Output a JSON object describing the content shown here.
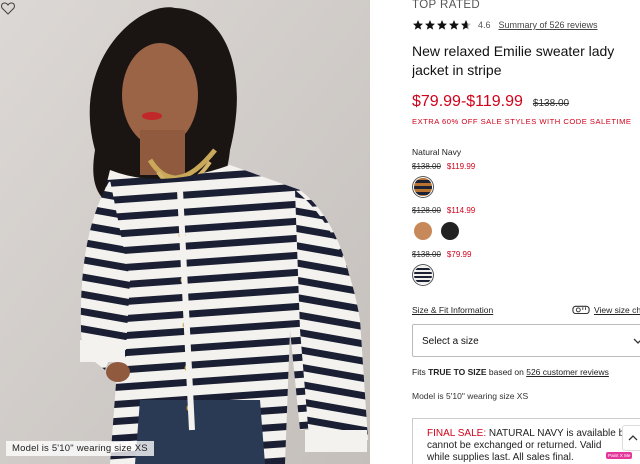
{
  "product_image": {
    "model_caption": "Model is 5'10\" wearing size XS",
    "favorite_icon": "heart-outline-icon"
  },
  "product": {
    "badge": "TOP RATED",
    "rating": "4.6",
    "rating_stars": 4.6,
    "reviews_link": "Summary of 526 reviews",
    "title": "New relaxed Emilie sweater lady jacket in stripe",
    "price_range": "$79.99-$119.99",
    "original_price": "$138.00",
    "promo": "EXTRA 60% OFF SALE STYLES WITH CODE SALETIME",
    "selected_color": "Natural Navy",
    "price_groups": [
      {
        "was": "$138.00",
        "now": "$119.99"
      },
      {
        "was": "$128.00",
        "now": "$114.99"
      },
      {
        "was": "$138.00",
        "now": "$79.99"
      }
    ]
  },
  "colors": {
    "accent_red": "#d0021b",
    "swatch_tan": "#c8895a",
    "swatch_black": "#222222",
    "swatch_stripe_dark": "#1c2233",
    "swatch_stripe_orange": "#b8742f"
  },
  "size": {
    "size_fit_link": "Size & Fit Information",
    "view_size_chart_link": "View size chart",
    "size_select_placeholder": "Select a size",
    "fits_prefix": "Fits",
    "fits_value": "TRUE TO SIZE",
    "fits_middle": "based on",
    "fits_link": "526 customer reviews",
    "model_info": "Model is 5'10\" wearing size XS"
  },
  "final_sale": {
    "label": "FINAL SALE:",
    "text_line1": " NATURAL NAVY is available b",
    "text_line2": "cannot be exchanged or returned. Valid",
    "text_line3": "while supplies last. All sales final."
  },
  "widgets": {
    "paint_badge": "Paint X Me"
  }
}
